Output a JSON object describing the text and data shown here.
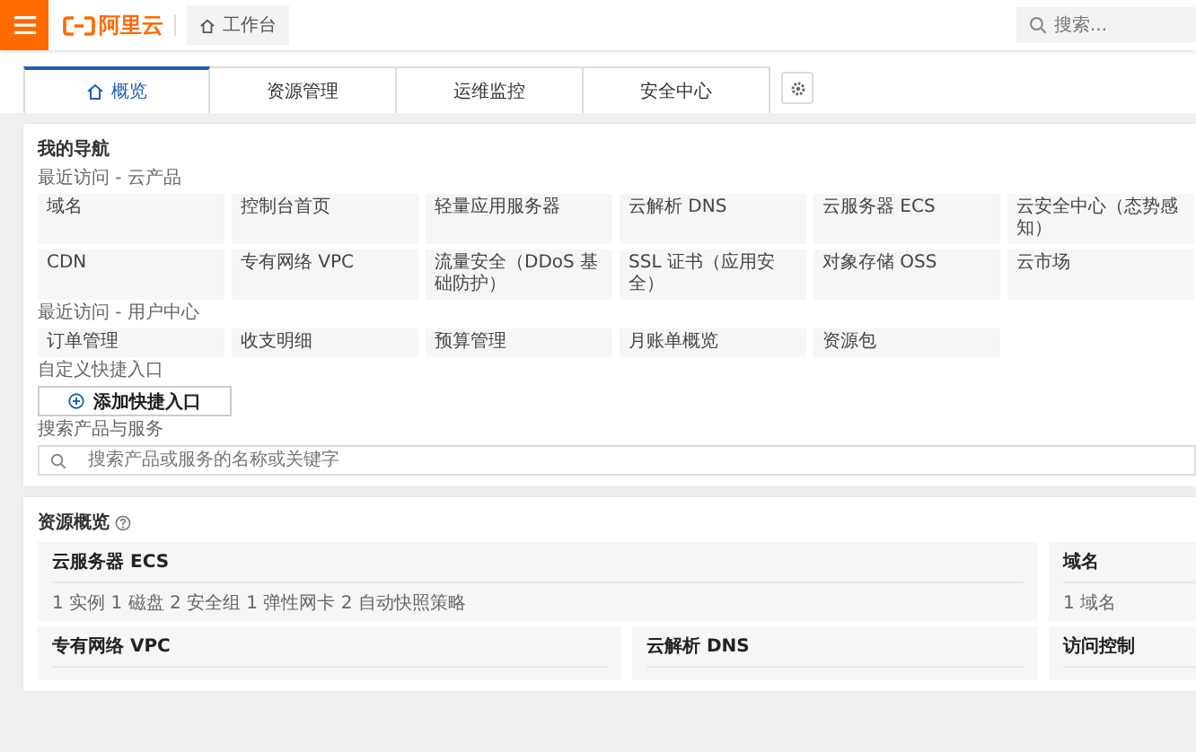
{
  "header": {
    "logo": "阿里云",
    "breadcrumb": "工作台",
    "search": {
      "placeholder": "搜索..."
    }
  },
  "tabs": [
    {
      "label": "概览",
      "selected": true
    },
    {
      "label": "资源管理",
      "selected": false
    },
    {
      "label": "运维监控",
      "selected": false
    },
    {
      "label": "安全中心",
      "selected": false
    }
  ],
  "navigation": {
    "title": "我的导航",
    "groups": [
      {
        "title": "最近访问 - 云产品",
        "items": [
          "域名",
          "控制台首页",
          "轻量应用服务器",
          "云解析 DNS",
          "云服务器 ECS",
          "云安全中心（态势感知）",
          "CDN",
          "专有网络 VPC",
          "流量安全（DDoS 基础防护）",
          "SSL 证书（应用安全）",
          "对象存储 OSS",
          "云市场"
        ]
      },
      {
        "title": "最近访问 - 用户中心",
        "items": [
          "订单管理",
          "收支明细",
          "预算管理",
          "月账单概览",
          "资源包"
        ]
      }
    ],
    "shortcut_title": "自定义快捷入口",
    "add_button": "添加快捷入口",
    "search_title": "搜索产品与服务",
    "search": {
      "placeholder": "搜索产品或服务的名称或关键字"
    }
  },
  "resources": {
    "title": "资源概览",
    "cards": [
      {
        "title": "云服务器 ECS",
        "summary": "1 实例 1 磁盘 2 安全组 1 弹性网卡 2 自动快照策略"
      },
      {
        "title": "域名",
        "summary": "1 域名"
      },
      {
        "title": "专有网络 VPC"
      },
      {
        "title": "云解析 DNS"
      },
      {
        "title": "访问控制"
      }
    ]
  }
}
